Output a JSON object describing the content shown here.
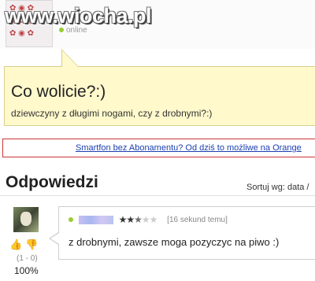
{
  "watermark": "www.wiocha.pl",
  "author": {
    "status": "online"
  },
  "question": {
    "title": "Co wolicie?:)",
    "subtitle": "dziewczyny z długimi nogami, czy z drobnymi?:)"
  },
  "ad": {
    "link_text": "Smartfon bez Abonamentu? Od dziś to możliwe na Orange"
  },
  "answers_section": {
    "title": "Odpowiedzi",
    "sort_label": "Sortuj wg: data /"
  },
  "answer": {
    "rating_stars": 2.5,
    "rating_max": 5,
    "time": "[16 sekund temu]",
    "text": "z drobnymi, zawsze moga pozyczyc na piwo :)",
    "votes": "(1 - 0)",
    "percent": "100%"
  },
  "colors": {
    "question_bg": "#fff9cc",
    "ad_border": "#cc3333",
    "link": "#1a3fb0",
    "online_dot": "#99cc33"
  },
  "icons": [
    "thumbs-up-icon",
    "thumbs-down-icon",
    "online-dot-icon",
    "star-icon"
  ]
}
